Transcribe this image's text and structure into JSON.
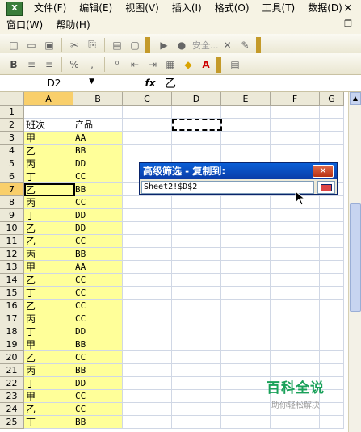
{
  "menu": {
    "row1": [
      "文件(F)",
      "编辑(E)",
      "视图(V)",
      "插入(I)",
      "格式(O)",
      "工具(T)",
      "数据(D)"
    ],
    "row2": [
      "窗口(W)",
      "帮助(H)"
    ]
  },
  "toolbar": {
    "security_label": "安全..."
  },
  "formula_bar": {
    "name_box": "D2",
    "fx_label": "fx",
    "value": "乙"
  },
  "columns": [
    "A",
    "B",
    "C",
    "D",
    "E",
    "F",
    "G"
  ],
  "rows": [
    "1",
    "2",
    "3",
    "4",
    "5",
    "6",
    "7",
    "8",
    "9",
    "10",
    "11",
    "12",
    "13",
    "14",
    "15",
    "16",
    "17",
    "18",
    "19",
    "20",
    "21",
    "22",
    "23",
    "24",
    "25"
  ],
  "table": {
    "headers": [
      "班次",
      "产品"
    ],
    "data": [
      [
        "甲",
        "AA"
      ],
      [
        "乙",
        "BB"
      ],
      [
        "丙",
        "DD"
      ],
      [
        "丁",
        "CC"
      ],
      [
        "乙",
        "BB"
      ],
      [
        "丙",
        "CC"
      ],
      [
        "丁",
        "DD"
      ],
      [
        "乙",
        "DD"
      ],
      [
        "乙",
        "CC"
      ],
      [
        "丙",
        "BB"
      ],
      [
        "甲",
        "AA"
      ],
      [
        "乙",
        "CC"
      ],
      [
        "丁",
        "CC"
      ],
      [
        "乙",
        "CC"
      ],
      [
        "丙",
        "CC"
      ],
      [
        "丁",
        "DD"
      ],
      [
        "甲",
        "BB"
      ],
      [
        "乙",
        "CC"
      ],
      [
        "丙",
        "BB"
      ],
      [
        "丁",
        "DD"
      ],
      [
        "甲",
        "CC"
      ],
      [
        "乙",
        "CC"
      ],
      [
        "丁",
        "BB"
      ]
    ]
  },
  "dialog": {
    "title": "高级筛选 - 复制到:",
    "close": "✕",
    "input_value": "Sheet2!$D$2"
  },
  "watermark": {
    "main": "百科全说",
    "sub": "助你轻松解决"
  },
  "colors": {
    "highlight": "#ffff99",
    "selected_header": "#f9cf6b",
    "dialog_title": "#0a4fc0",
    "watermark": "#1aa15a"
  }
}
